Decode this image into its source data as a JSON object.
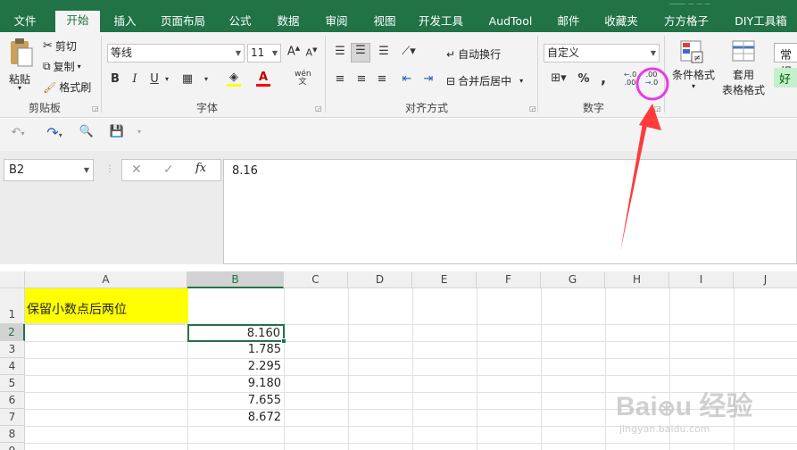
{
  "tabs": [
    "文件",
    "开始",
    "插入",
    "页面布局",
    "公式",
    "数据",
    "审阅",
    "视图",
    "开发工具",
    "AudTool",
    "邮件",
    "收藏夹",
    "方方格子",
    "DIY工具箱"
  ],
  "active_tab": "开始",
  "clipboard": {
    "paste": "粘贴",
    "cut": "剪切",
    "copy": "复制",
    "format_painter": "格式刷",
    "label": "剪贴板"
  },
  "font": {
    "name": "等线",
    "size": "11",
    "bold": "B",
    "italic": "I",
    "underline": "U",
    "label": "字体"
  },
  "alignment": {
    "wrap_text": "自动换行",
    "merge_center": "合并后居中",
    "label": "对齐方式"
  },
  "number": {
    "format": "自定义",
    "percent": "%",
    "comma": ",",
    "label": "数字",
    "increase_decimal": ".00→.0",
    "decrease_decimal": ".00→.0"
  },
  "styles": {
    "conditional": "条件格式",
    "table_format_1": "套用",
    "table_format_2": "表格格式",
    "style_normal": "常规",
    "style_good": "好"
  },
  "name_box": "B2",
  "formula_value": "8.16",
  "columns": [
    "A",
    "B",
    "C",
    "D",
    "E",
    "F",
    "G",
    "H",
    "I",
    "J"
  ],
  "rows": [
    "1",
    "2",
    "3",
    "4",
    "5",
    "6",
    "7",
    "8",
    "9"
  ],
  "cells": {
    "A1": "保留小数点后两位",
    "B2": "8.160",
    "B3": "1.785",
    "B4": "2.295",
    "B5": "9.180",
    "B6": "7.655",
    "B7": "8.672"
  },
  "colors": {
    "brand": "#217346",
    "highlight": "#ffff00",
    "annotation": "#ff3b3b",
    "circle": "#e83ae8"
  }
}
